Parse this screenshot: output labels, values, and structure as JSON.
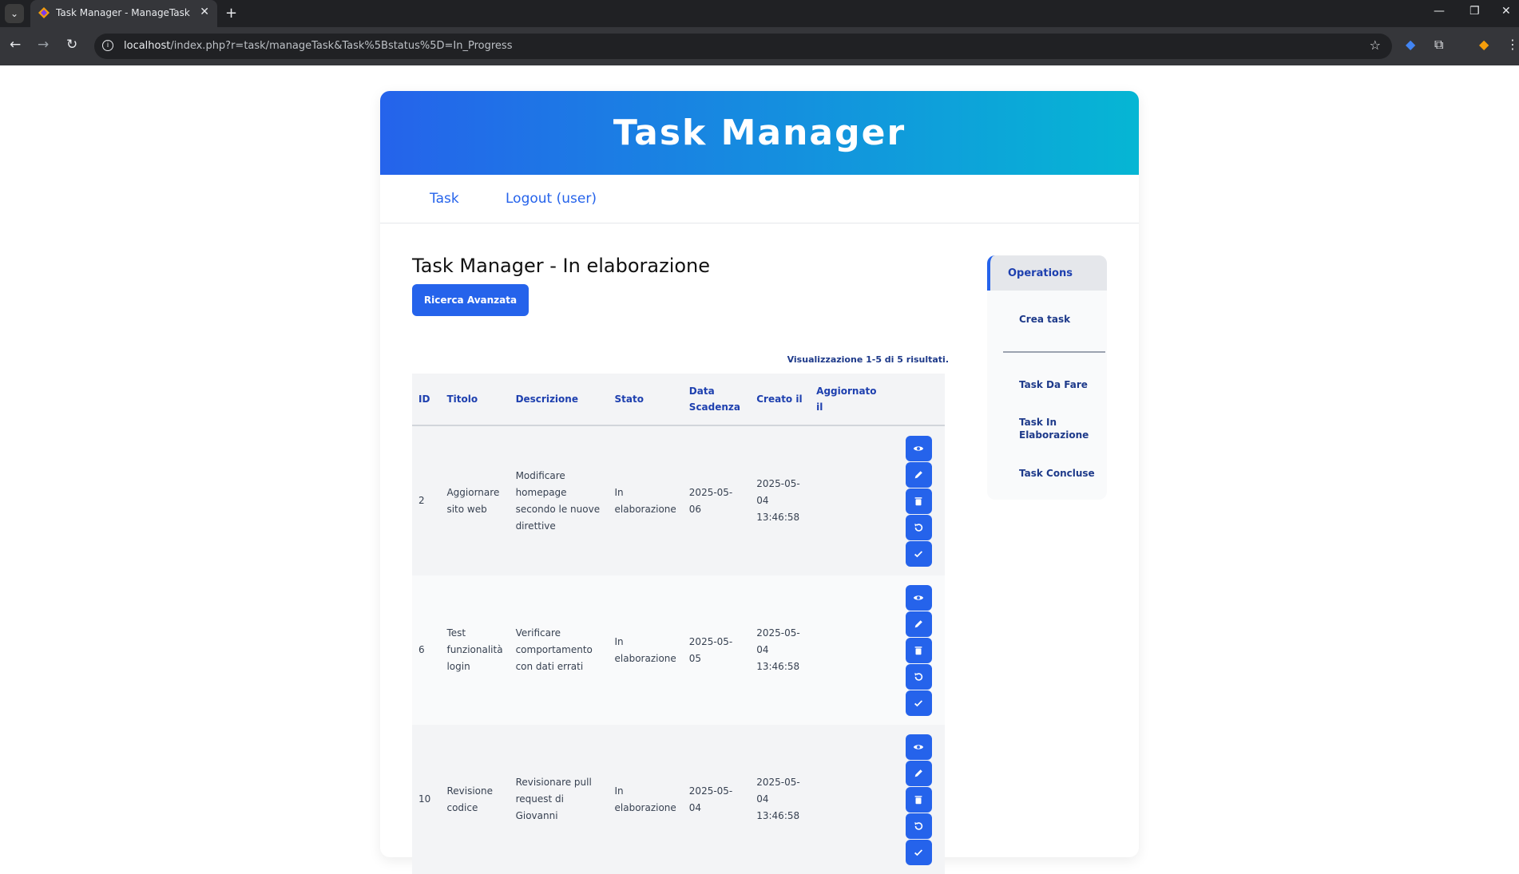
{
  "browser": {
    "tab_title": "Task Manager - ManageTask Task",
    "url_host": "localhost",
    "url_path": "/index.php?r=task/manageTask&Task%5Bstatus%5D=In_Progress"
  },
  "header": {
    "title": "Task Manager"
  },
  "nav": {
    "items": [
      {
        "label": "Task"
      },
      {
        "label": "Logout (user)"
      }
    ]
  },
  "main": {
    "title": "Task Manager - In elaborazione",
    "search_button": "Ricerca Avanzata",
    "summary": "Visualizzazione 1-5 di 5 risultati."
  },
  "table": {
    "columns": [
      "ID",
      "Titolo",
      "Descrizione",
      "Stato",
      "Data Scadenza",
      "Creato il",
      "Aggiornato il"
    ],
    "rows": [
      {
        "id": "2",
        "title": "Aggiornare sito web",
        "description": "Modificare homepage secondo le nuove direttive",
        "status": "In elaborazione",
        "due": "2025-05-06",
        "created": "2025-05-04 13:46:58",
        "updated": ""
      },
      {
        "id": "6",
        "title": "Test funzionalità login",
        "description": "Verificare comportamento con dati errati",
        "status": "In elaborazione",
        "due": "2025-05-05",
        "created": "2025-05-04 13:46:58",
        "updated": ""
      },
      {
        "id": "10",
        "title": "Revisione codice",
        "description": "Revisionare pull request di Giovanni",
        "status": "In elaborazione",
        "due": "2025-05-04",
        "created": "2025-05-04 13:46:58",
        "updated": ""
      }
    ]
  },
  "sidebar": {
    "header": "Operations",
    "items": [
      {
        "label": "Crea task"
      },
      {
        "label": "Task Da Fare"
      },
      {
        "label": "Task In Elaborazione"
      },
      {
        "label": "Task Concluse"
      }
    ]
  },
  "icons": {
    "row_actions": [
      "eye-icon",
      "pencil-icon",
      "trash-icon",
      "undo-icon",
      "check-icon"
    ]
  },
  "colors": {
    "primary": "#2563eb",
    "gradient_end": "#06b6d4",
    "browser_dark": "#202124"
  }
}
